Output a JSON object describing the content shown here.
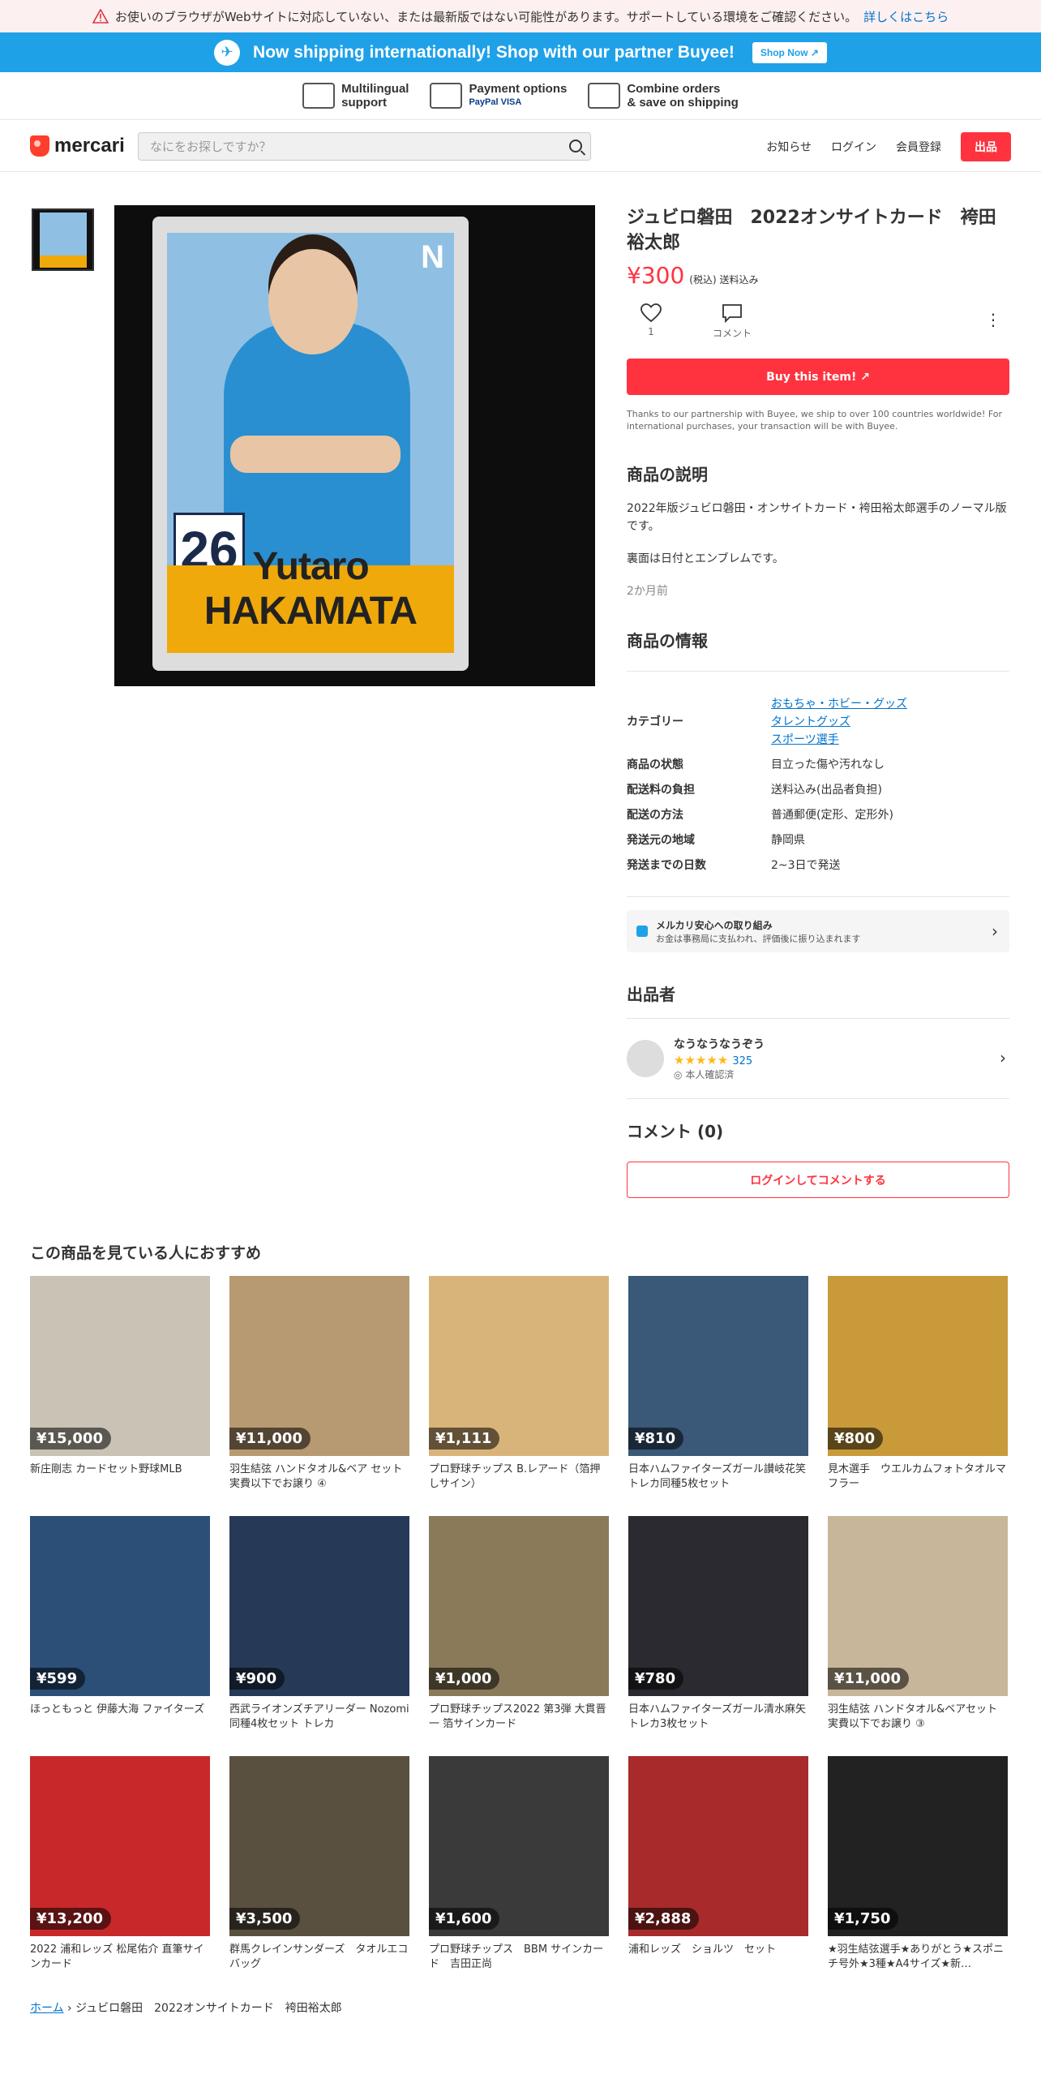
{
  "warning": {
    "text": "お使いのブラウザがWebサイトに対応していない、または最新版ではない可能性があります。サポートしている環境をご確認ください。",
    "link": "詳しくはこちら"
  },
  "buyee": {
    "text": "Now shipping internationally! Shop with our partner Buyee!",
    "button": "Shop Now"
  },
  "features": [
    {
      "icon": "translate-icon",
      "line1": "Multilingual",
      "line2": "support"
    },
    {
      "icon": "card-icon",
      "line1": "Payment options",
      "line2": "PayPal VISA"
    },
    {
      "icon": "box-icon",
      "line1": "Combine orders",
      "line2": "& save on shipping"
    }
  ],
  "header": {
    "brand": "mercari",
    "search_placeholder": "なにをお探しですか？",
    "nav": [
      "お知らせ",
      "ログイン",
      "会員登録"
    ],
    "sell": "出品"
  },
  "product": {
    "card_name": "Yutaro HAKAMATA",
    "card_number": "26",
    "card_code": "N",
    "title": "ジュビロ磐田　2022オンサイトカード　袴田裕太郎",
    "price": "¥300",
    "price_note": "(税込) 送料込み",
    "likes": "1",
    "comment_label": "コメント",
    "buy": "Buy this item!",
    "note": "Thanks to our partnership with Buyee, we ship to over 100 countries worldwide! For international purchases, your transaction will be with Buyee.",
    "desc_title": "商品の説明",
    "desc1": "2022年版ジュビロ磐田・オンサイトカード・袴田裕太郎選手のノーマル版です。",
    "desc2": "裏面は日付とエンブレムです。",
    "ago": "2か月前",
    "info_title": "商品の情報",
    "category_label": "カテゴリー",
    "categories": [
      "おもちゃ・ホビー・グッズ",
      "タレントグッズ",
      "スポーツ選手"
    ],
    "rows": [
      {
        "k": "商品の状態",
        "v": "目立った傷や汚れなし"
      },
      {
        "k": "配送料の負担",
        "v": "送料込み(出品者負担)"
      },
      {
        "k": "配送の方法",
        "v": "普通郵便(定形、定形外)"
      },
      {
        "k": "発送元の地域",
        "v": "静岡県"
      },
      {
        "k": "発送までの日数",
        "v": "2~3日で発送"
      }
    ],
    "safe_title": "メルカリ安心への取り組み",
    "safe_sub": "お金は事務局に支払われ、評価後に振り込まれます",
    "seller_title": "出品者",
    "seller_name": "なうなうなうぞう",
    "seller_rating": "325",
    "seller_verified": "本人確認済",
    "comment_title": "コメント (0)",
    "login_comment": "ログインしてコメントする"
  },
  "recommend": {
    "title": "この商品を見ている人におすすめ",
    "items": [
      {
        "price": "¥15,000",
        "name": "新庄剛志 カードセット野球MLB",
        "color": "#c9c3b5"
      },
      {
        "price": "¥11,000",
        "name": "羽生結弦 ハンドタオル&ベア セット 実費以下でお譲り ④",
        "color": "#b89a72"
      },
      {
        "price": "¥1,111",
        "name": "プロ野球チップス B.レアード（箔押しサイン）",
        "color": "#d9b47a"
      },
      {
        "price": "¥810",
        "name": "日本ハムファイターズガール讃岐花笑トレカ同種5枚セット",
        "color": "#3a5878"
      },
      {
        "price": "¥800",
        "name": "見木選手　ウエルカムフォトタオルマフラー",
        "color": "#c89a3a"
      },
      {
        "price": "¥599",
        "name": "ほっともっと 伊藤大海 ファイターズ",
        "color": "#2c4f78"
      },
      {
        "price": "¥900",
        "name": "西武ライオンズチアリーダー Nozomi同種4枚セット トレカ",
        "color": "#263a58"
      },
      {
        "price": "¥1,000",
        "name": "プロ野球チップス2022 第3弾 大貫晋一 箔サインカード",
        "color": "#8a7a5a"
      },
      {
        "price": "¥780",
        "name": "日本ハムファイターズガール清水麻矢トレカ3枚セット",
        "color": "#2a2a30"
      },
      {
        "price": "¥11,000",
        "name": "羽生結弦 ハンドタオル&ベアセット 実費以下でお譲り ③",
        "color": "#c8b69a"
      },
      {
        "price": "¥13,200",
        "name": "2022 浦和レッズ 松尾佑介 直筆サインカード",
        "color": "#c8282a"
      },
      {
        "price": "¥3,500",
        "name": "群馬クレインサンダーズ　タオルエコバッグ",
        "color": "#5a5040"
      },
      {
        "price": "¥1,600",
        "name": "プロ野球チップス　BBM サインカード　吉田正尚",
        "color": "#3a3a3a"
      },
      {
        "price": "¥2,888",
        "name": "浦和レッズ　ショルツ　セット",
        "color": "#a82a2a"
      },
      {
        "price": "¥1,750",
        "name": "★羽生結弦選手★ありがとう★スポニチ号外★3種★A4サイズ★新…",
        "color": "#222222"
      }
    ]
  },
  "breadcrumb": {
    "home": "ホーム",
    "current": "ジュビロ磐田　2022オンサイトカード　袴田裕太郎"
  }
}
